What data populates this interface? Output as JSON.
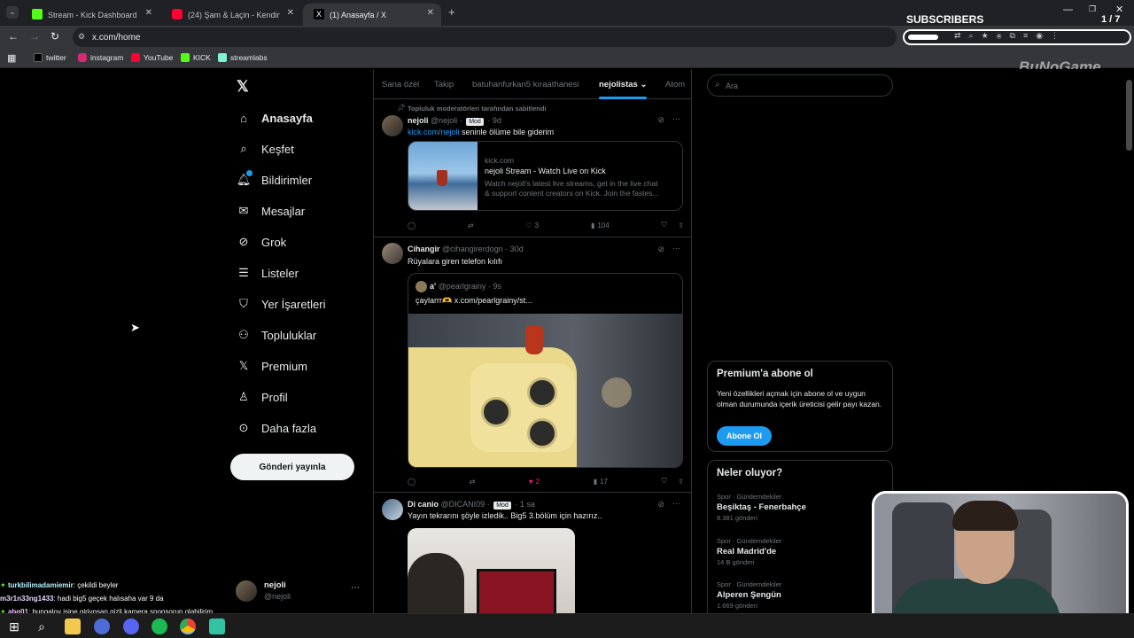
{
  "browser": {
    "tabs": [
      {
        "title": "Stream - Kick Dashboard",
        "active": false
      },
      {
        "title": "(24) Şam & Laçin - Kendine İyi Ba",
        "active": false
      },
      {
        "title": "(1) Anasayfa / X",
        "active": true
      }
    ],
    "url": "x.com/home",
    "bookmarks": [
      "twitter",
      "instagram",
      "YouTube",
      "KICK",
      "streamlabs"
    ]
  },
  "overlay": {
    "subscribers_label": "SUBSCRIBERS",
    "subscribers_count": "1 / 7",
    "brand": "BuNoGame"
  },
  "sidebar": {
    "items": [
      {
        "label": "Anasayfa",
        "icon": "home-icon"
      },
      {
        "label": "Keşfet",
        "icon": "search-icon"
      },
      {
        "label": "Bildirimler",
        "icon": "bell-icon"
      },
      {
        "label": "Mesajlar",
        "icon": "mail-icon"
      },
      {
        "label": "Grok",
        "icon": "grok-icon"
      },
      {
        "label": "Listeler",
        "icon": "list-icon"
      },
      {
        "label": "Yer İşaretleri",
        "icon": "bookmark-icon"
      },
      {
        "label": "Topluluklar",
        "icon": "communities-icon"
      },
      {
        "label": "Premium",
        "icon": "x-logo-icon"
      },
      {
        "label": "Profil",
        "icon": "profile-icon"
      },
      {
        "label": "Daha fazla",
        "icon": "more-circle-icon"
      }
    ],
    "post_button": "Gönderi yayınla",
    "account": {
      "name": "nejoli",
      "handle": "@nejoli"
    }
  },
  "feed": {
    "tabs": [
      "Sana özel",
      "Takip",
      "batuhanfurkan5 kıraathanesi",
      "nejolistas",
      "Atom"
    ],
    "selected_tab": "nejolistas",
    "posts": [
      {
        "pinned_note": "Topluluk moderatörleri tarafından sabitlendi",
        "name": "nejoli",
        "handle": "@nejoli",
        "badge": "Mod",
        "time": "9d",
        "link": "kick.com/nejoli",
        "text": "seninle ölüme bile giderim",
        "card": {
          "domain": "kick.com",
          "title": "nejoli Stream - Watch Live on Kick",
          "desc1": "Watch nejoli's latest live streams, get in the live chat",
          "desc2": "& support content creators on Kick. Join the fastes..."
        },
        "likes": "3",
        "views": "104",
        "liked": false
      },
      {
        "name": "Cihangir",
        "handle": "@cihangirerdogn",
        "time": "30d",
        "text": "Rüyalara giren telefon kılıfı",
        "quote": {
          "name": "a'",
          "handle": "@pearlgrainy",
          "time": "9s",
          "text": "çaylarrr🫶 x.com/pearlgrainy/st..."
        },
        "likes": "2",
        "views": "17",
        "liked": true
      },
      {
        "name": "Di canio",
        "handle": "@DICANI09",
        "badge": "Mod",
        "time": "1 sa",
        "text": "Yayın tekrarını şöyle izledik.. Big5 3.bölüm için hazırız.."
      }
    ]
  },
  "right": {
    "search_placeholder": "Ara",
    "premium": {
      "title": "Premium'a abone ol",
      "desc": "Yeni özellikleri açmak için abone ol ve uygun olman durumunda içerik üreticisi gelir payı kazan.",
      "button": "Abone Ol"
    },
    "trends": {
      "title": "Neler oluyor?",
      "items": [
        {
          "category": "Spor · Gündemdekiler",
          "name": "Beşiktaş - Fenerbahçe",
          "count": "8.381 gönderi"
        },
        {
          "category": "Spor · Gündemdekiler",
          "name": "Real Madrid'de",
          "count": "14 B gönderi"
        },
        {
          "category": "Spor · Gündemdekiler",
          "name": "Alperen Şengün",
          "count": "1.669 gönderi"
        }
      ]
    }
  },
  "chat": [
    {
      "user": "turkbilimadamiemir",
      "msg": ": çekildi beyler",
      "color": "#b6f3ff"
    },
    {
      "user": "m3r1n33ng1433",
      "msg": ": hadi big5 geçek halısaha var 9 da",
      "color": "#e6d8ff"
    },
    {
      "user": "abg01",
      "msg": ": bungalov işine giriyosan gizli kamera sponsorun olabilirim",
      "color": "#f7c3ff"
    }
  ]
}
